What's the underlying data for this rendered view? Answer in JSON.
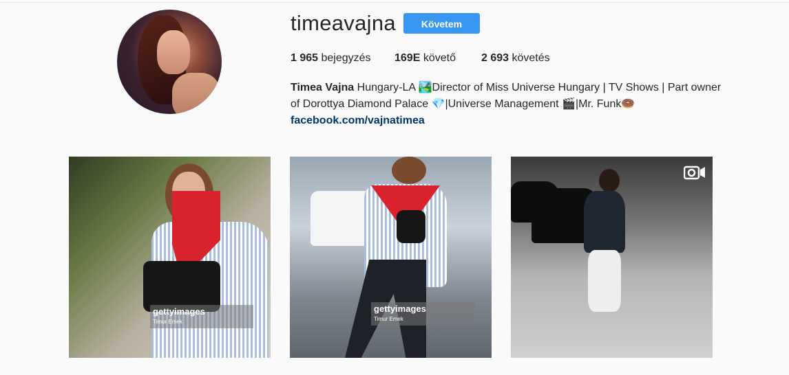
{
  "profile": {
    "username": "timeavajna",
    "follow_label": "Követem"
  },
  "stats": {
    "posts_count": "1 965",
    "posts_label": "bejegyzés",
    "followers_count": "169E",
    "followers_label": "követő",
    "following_count": "2 693",
    "following_label": "követés"
  },
  "bio": {
    "name": "Timea Vajna",
    "line1": "Hungary-LA 🏞️Director of Miss Universe Hungary | TV Shows | Part owner",
    "line2": "of Dorottya Diamond Palace 💎|Universe Management 🎬|Mr. Funk🍩",
    "link": "facebook.com/vajnatimea"
  },
  "posts": [
    {
      "watermark_brand": "gettyimages",
      "watermark_credit": "Timur Emek"
    },
    {
      "watermark_brand": "gettyimages",
      "watermark_credit": "Timur Emek"
    },
    {
      "icon": "video-icon"
    }
  ],
  "colors": {
    "accent": "#3897f0",
    "link": "#003569",
    "background": "#fafafa"
  }
}
